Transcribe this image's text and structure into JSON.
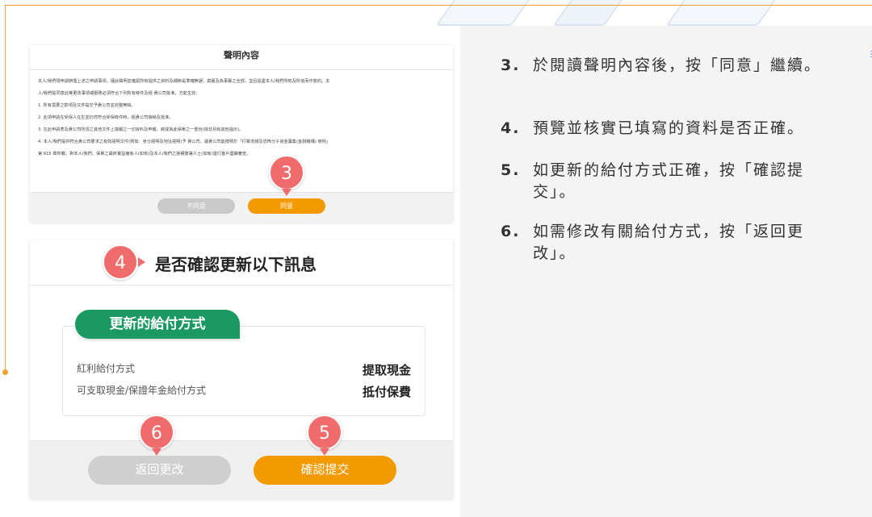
{
  "statement_panel": {
    "title": "聲明內容",
    "paragraphs": [
      "本人/我們現申請辦理上述之申請事項，謹此聲明並確認所有提供之資料及細節是準確無誤，真實及為事實之全部，並且是盡本人/我們所知及所信而作答的。本",
      "人/我們提同意此等更改事項或服務必須符合下列所有條件及經 貴公司批准，方能生效：",
      "1. 所有需要之款項及文件提交予貴公司並完整無缺。",
      "2. 此項申請在受保人在生並仍然符合受保條件時，經貴公司接納及批准。",
      "3. 在此申請表及貴公司所須之其他文件上填報之一切資料及申報，將成為此保單之一部份(除非另有其他指示)。",
      "4. 本人/我們提供符合貴公司要求之有效證明文件(例如：身分證明及地址證明)予 貴公司，讓貴公司能按照於「打擊洗錢及恐怖分子資金籌集(金融機構) 條例」",
      "第 615 章所載，對本人/我們、保單之最終實益擁有人(如有)及本人/我們之授權簽署人士(如有)進行客戶盡職審查。"
    ],
    "decline_button": "不同意",
    "agree_button": "同意"
  },
  "confirm_panel": {
    "title": "是否確認更新以下訊息",
    "section_tab": "更新的給付方式",
    "rows": [
      {
        "label": "紅利給付方式",
        "value": "提取現金"
      },
      {
        "label": "可支取現金/保證年金給付方式",
        "value": "抵付保費"
      }
    ],
    "back_button": "返回更改",
    "confirm_button": "確認提交"
  },
  "step_badges": {
    "s3": "3",
    "s4": "4",
    "s5": "5",
    "s6": "6"
  },
  "instructions": [
    {
      "num": "3.",
      "text": "於閱讀聲明內容後，按「同意」繼續。"
    },
    {
      "num": "4.",
      "text": "預覽並核實已填寫的資料是否正確。"
    },
    {
      "num": "5.",
      "text": "如更新的給付方式正確，按「確認提交」。"
    },
    {
      "num": "6.",
      "text": "如需修改有關給付方式，按「返回更改」。"
    }
  ],
  "colors": {
    "accent_orange": "#f39a00",
    "badge_red": "#f06c6c",
    "tab_green": "#1a9a62",
    "disabled_gray": "#c9c9c9"
  }
}
